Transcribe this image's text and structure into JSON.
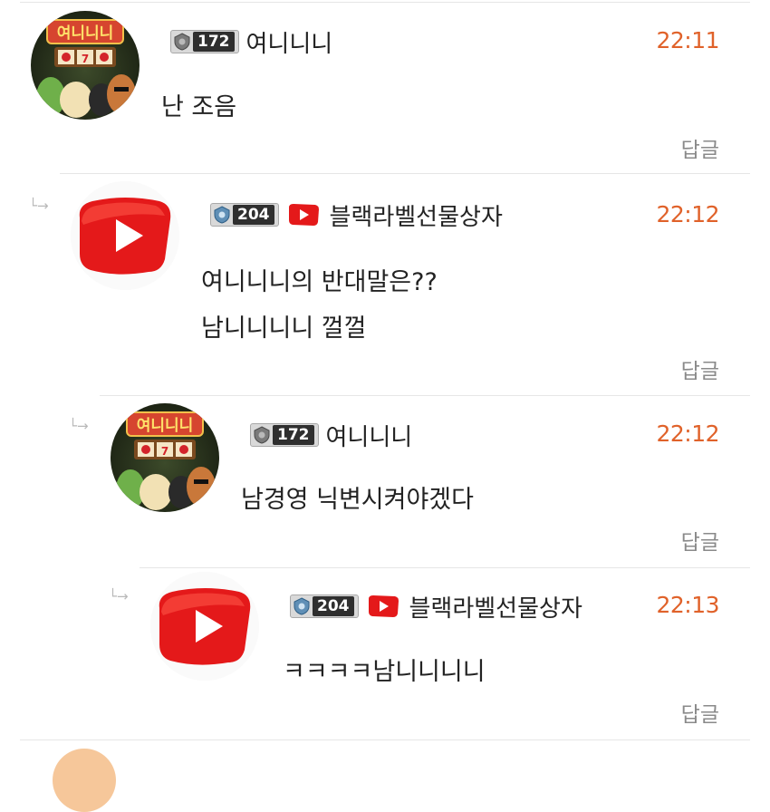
{
  "comments": [
    {
      "author": "여니니니",
      "level": "172",
      "time": "22:11",
      "lines": [
        "난 조음"
      ],
      "reply": "답글",
      "avatar_text": "여니니니"
    },
    {
      "author": "블랙라벨선물상자",
      "level": "204",
      "time": "22:12",
      "lines": [
        "여니니니의 반대말은??",
        "남니니니니 껄껄"
      ],
      "reply": "답글"
    },
    {
      "author": "여니니니",
      "level": "172",
      "time": "22:12",
      "lines": [
        "남경영 닉변시켜야겠다"
      ],
      "reply": "답글",
      "avatar_text": "여니니니"
    },
    {
      "author": "블랙라벨선물상자",
      "level": "204",
      "time": "22:13",
      "lines": [
        "ㅋㅋㅋㅋ남니니니니"
      ],
      "reply": "답글"
    }
  ],
  "reply_arrow_icon": "reply-arrow-icon",
  "colors": {
    "time": "#e0622a",
    "reply": "#8a8a8a",
    "youtube_red": "#e4191a"
  }
}
